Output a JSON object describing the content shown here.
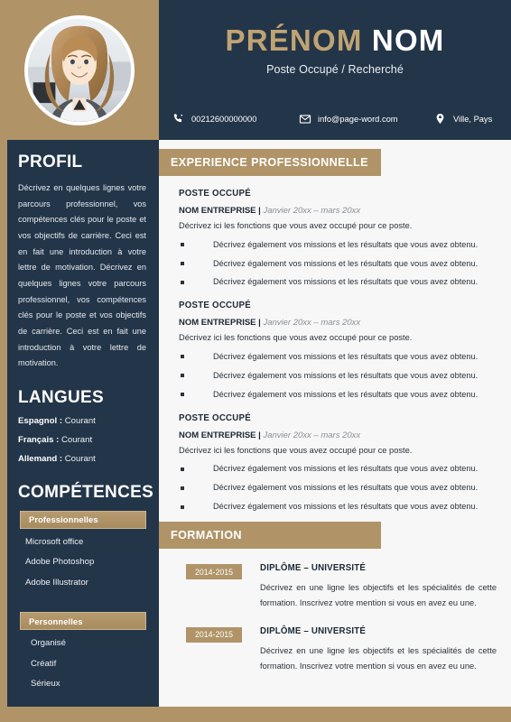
{
  "header": {
    "first_name": "PRÉNOM",
    "last_name": "NOM",
    "subtitle": "Poste Occupé / Recherché",
    "contacts": [
      {
        "icon": "phone-icon",
        "value": "00212600000000"
      },
      {
        "icon": "envelope-icon",
        "value": "info@page-word.com"
      },
      {
        "icon": "map-pin-icon",
        "value": "Ville, Pays"
      }
    ]
  },
  "sidebar": {
    "profil": {
      "heading": "PROFIL",
      "text": "Décrivez en quelques lignes votre parcours professionnel, vos compétences clés pour le poste et vos objectifs de carrière. Ceci est en fait une introduction à votre lettre de motivation. Décrivez en quelques lignes votre parcours professionnel, vos compétences clés pour le poste et vos objectifs de carrière. Ceci est en fait une introduction à votre lettre de motivation."
    },
    "langues": {
      "heading": "LANGUES",
      "items": [
        {
          "name": "Espagnol :",
          "level": "Courant"
        },
        {
          "name": "Français :",
          "level": "Courant"
        },
        {
          "name": "Allemand :",
          "level": "Courant"
        }
      ]
    },
    "competences": {
      "heading": "COMPÉTENCES",
      "groups": [
        {
          "badge": "Professionnelles",
          "items": [
            "Microsoft office",
            "Adobe Photoshop",
            "Adobe Illustrator"
          ]
        },
        {
          "badge": "Personnelles",
          "items": [
            "Organisé",
            "Créatif",
            "Sérieux"
          ]
        }
      ]
    }
  },
  "main": {
    "experience": {
      "heading": "EXPERIENCE PROFESSIONNELLE",
      "jobs": [
        {
          "title": "POSTE OCCUPÉ",
          "company": "NOM ENTREPRISE |",
          "dates": "Janvier 20xx – mars 20xx",
          "description": "Décrivez ici les fonctions que vous avez occupé pour ce poste.",
          "bullets": [
            "Décrivez également vos missions et les résultats que vous avez obtenu.",
            "Décrivez également vos missions et les résultats que vous avez obtenu.",
            "Décrivez également vos missions et les résultats que vous avez obtenu."
          ]
        },
        {
          "title": "POSTE OCCUPÉ",
          "company": "NOM ENTREPRISE |",
          "dates": "Janvier 20xx – mars 20xx",
          "description": "Décrivez ici les fonctions que vous avez occupé pour ce poste.",
          "bullets": [
            "Décrivez également vos missions et les résultats que vous avez obtenu.",
            "Décrivez également vos missions et les résultats que vous avez obtenu.",
            "Décrivez également vos missions et les résultats que vous avez obtenu."
          ]
        },
        {
          "title": "POSTE OCCUPÉ",
          "company": "NOM ENTREPRISE |",
          "dates": "Janvier 20xx – mars 20xx",
          "description": "Décrivez ici les fonctions que vous avez occupé pour ce poste.",
          "bullets": [
            "Décrivez également vos missions et les résultats que vous avez obtenu.",
            "Décrivez également vos missions et les résultats que vous avez obtenu.",
            "Décrivez également vos missions et les résultats que vous avez obtenu."
          ]
        }
      ]
    },
    "formation": {
      "heading": "FORMATION",
      "entries": [
        {
          "date": "2014-2015",
          "title": "DIPLÔME – UNIVERSITÉ",
          "description": "Décrivez en une ligne les objectifs et les spécialités de cette formation. Inscrivez votre mention si vous en avez eu une."
        },
        {
          "date": "2014-2015",
          "title": "DIPLÔME – UNIVERSITÉ",
          "description": "Décrivez en une ligne les objectifs et les spécialités de cette formation. Inscrivez votre mention si vous en avez eu une."
        }
      ]
    }
  },
  "colors": {
    "tan": "#b09468",
    "navy": "#233549",
    "gold_text": "#c0a372",
    "paper": "#f7f7f7"
  }
}
